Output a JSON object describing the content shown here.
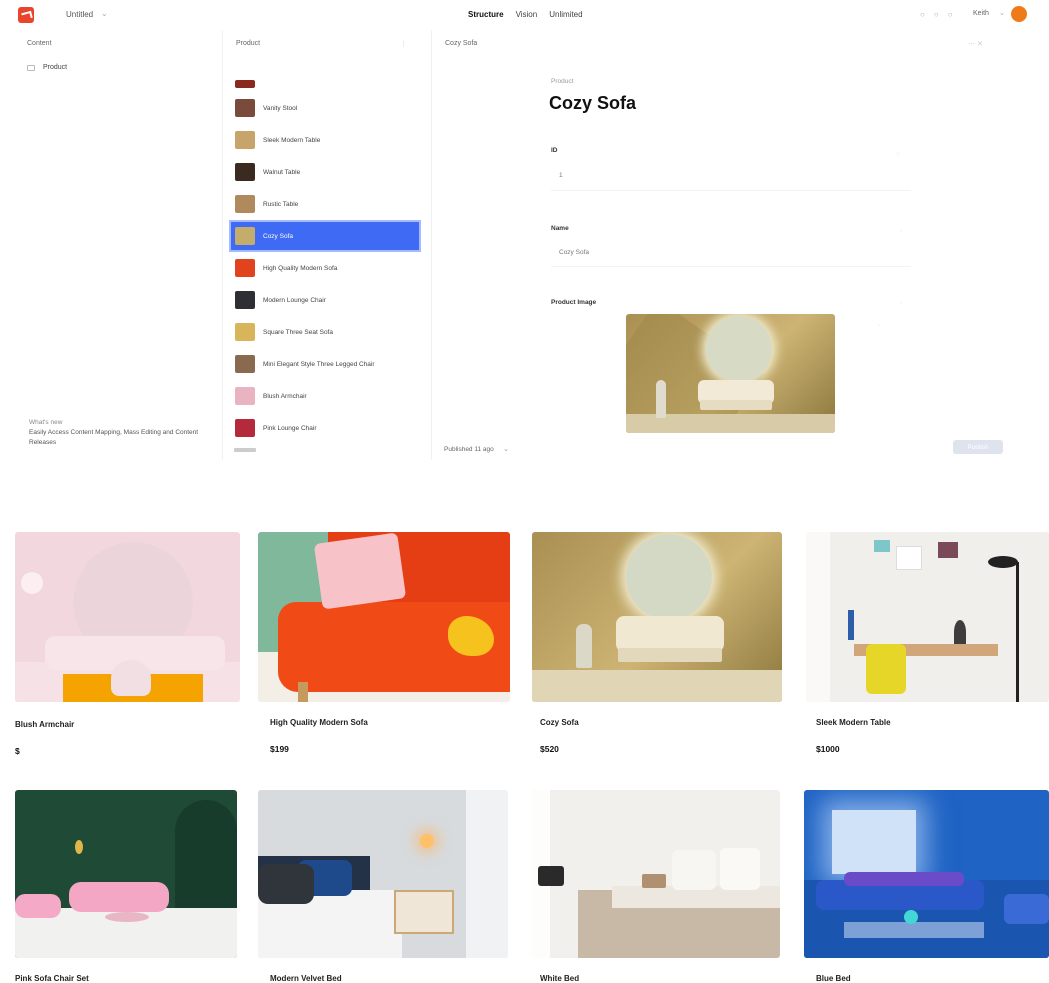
{
  "cms": {
    "project": "Untitled",
    "nav": [
      "Structure",
      "Vision",
      "Unlimited"
    ],
    "user": "Keith",
    "panes": {
      "left": "Content",
      "middle": "Product",
      "right": "Cozy Sofa"
    },
    "tree_item": "Product",
    "footer_note": {
      "title": "What's new",
      "text": "Easily Access Content Mapping, Mass Editing and Content Releases"
    },
    "documents": [
      {
        "label": "Vanity Stool",
        "color": "#7a4a3a"
      },
      {
        "label": "Sleek Modern Table",
        "color": "#c7a46a"
      },
      {
        "label": "Walnut Table",
        "color": "#3b2a20"
      },
      {
        "label": "Rustic Table",
        "color": "#b08a5c"
      },
      {
        "label": "Cozy Sofa",
        "color": "#c4ad6c"
      },
      {
        "label": "High Quality Modern Sofa",
        "color": "#e0431d"
      },
      {
        "label": "Modern Lounge Chair",
        "color": "#2d2f35"
      },
      {
        "label": "Square Three Seat Sofa",
        "color": "#d8b45a"
      },
      {
        "label": "Mini Elegant Style Three Legged Chair",
        "color": "#8a6a4e"
      },
      {
        "label": "Blush Armchair",
        "color": "#e9b3c2"
      },
      {
        "label": "Pink Lounge Chair",
        "color": "#b52a3a"
      }
    ],
    "selected_index": 4,
    "pagination": "Published 11 ago",
    "editor": {
      "breadcrumb": "Product",
      "title": "Cozy Sofa",
      "fields": [
        {
          "label": "ID",
          "value": "1"
        },
        {
          "label": "Name",
          "value": "Cozy Sofa"
        },
        {
          "label": "Product Image",
          "value": ""
        }
      ],
      "publish": "Publish"
    }
  },
  "shop": {
    "products": [
      {
        "name": "Blush Armchair",
        "price": "$"
      },
      {
        "name": "High Quality Modern Sofa",
        "price": "$199"
      },
      {
        "name": "Cozy Sofa",
        "price": "$520"
      },
      {
        "name": "Sleek Modern Table",
        "price": "$1000"
      },
      {
        "name": "Pink Sofa Chair Set",
        "price": ""
      },
      {
        "name": "Modern Velvet Bed",
        "price": ""
      },
      {
        "name": "White Bed",
        "price": ""
      },
      {
        "name": "Blue Bed",
        "price": ""
      }
    ]
  }
}
